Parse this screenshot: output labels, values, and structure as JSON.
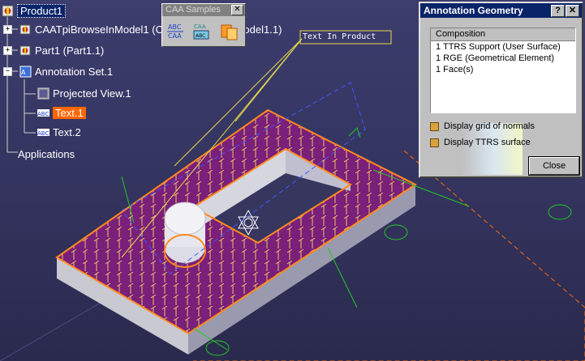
{
  "tree": {
    "root": "Product1",
    "model": "CAATpiBrowseInModel1 (CAATpiBrowseInModel1.1)",
    "part": "Part1 (Part1.1)",
    "annotation_set": "Annotation Set.1",
    "projected_view": "Projected View.1",
    "text1": "Text.1",
    "text2": "Text.2",
    "applications": "Applications",
    "node_icon_text": "ABC"
  },
  "toolbar": {
    "title": "CAA Samples",
    "close": "✕",
    "icon_texts": [
      "ABC",
      "CAA",
      "ABC",
      "CAA"
    ]
  },
  "dialog": {
    "title": "Annotation Geometry",
    "help_btn": "?",
    "close_x": "✕",
    "list_header": "Composition",
    "items": [
      "1 TTRS Support (User Surface)",
      "1 RGE (Geometrical Element)",
      "1 Face(s)"
    ],
    "check1": "Display grid of normals",
    "check2": "Display TTRS surface",
    "close_button": "Close"
  },
  "scene": {
    "callout": "Text In Product"
  },
  "colors": {
    "background": "#36365f",
    "top_face": "#7a1f7a",
    "highlight": "#ff8a1f",
    "annotation_green": "#22c822",
    "normals": "#ffe066",
    "selection": "#ff6600",
    "tree_selection": "#0a246a"
  }
}
